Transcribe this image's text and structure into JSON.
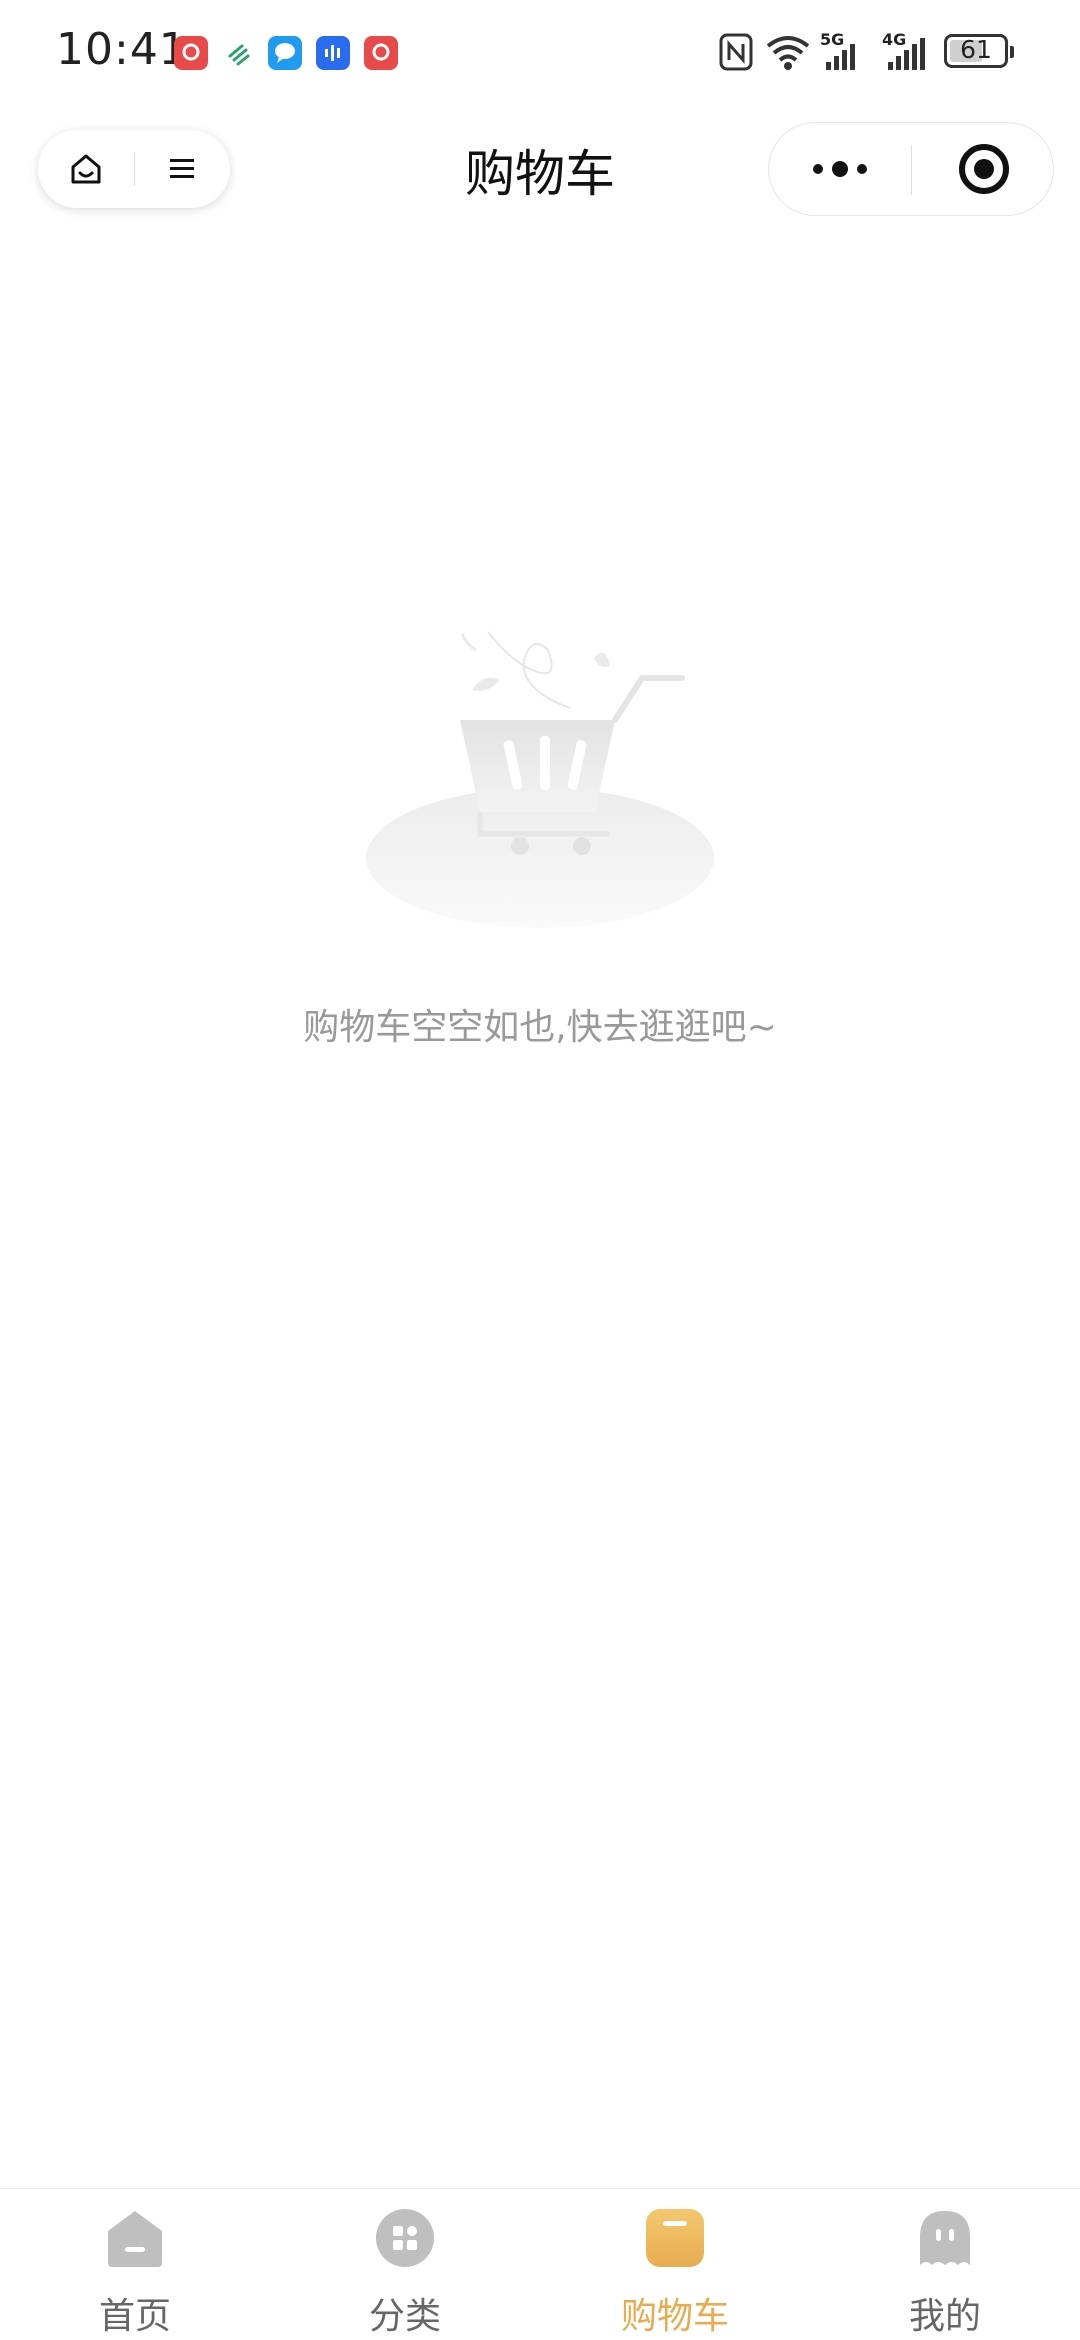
{
  "status_bar": {
    "time": "10:41",
    "notification_icons": [
      "huawei-app-icon",
      "mobile-network-app-icon",
      "messages-app-icon",
      "voice-app-icon",
      "huawei-app-icon"
    ],
    "network_5g": "5G",
    "network_4g": "4G",
    "battery": "61",
    "battery_level": 0.61
  },
  "nav": {
    "title": "购物车",
    "home_icon": "home-icon",
    "menu_icon": "menu-icon",
    "more_icon": "more-icon",
    "close_icon": "target-close-icon"
  },
  "empty_state": {
    "message": "购物车空空如也,快去逛逛吧~",
    "illustration": "empty-cart-illustration"
  },
  "tab_bar": {
    "active_color": "#e8ac4f",
    "inactive_color": "#bfbfbf",
    "items": [
      {
        "label": "首页",
        "icon": "home-tab-icon"
      },
      {
        "label": "分类",
        "icon": "category-tab-icon"
      },
      {
        "label": "购物车",
        "icon": "cart-tab-icon",
        "active": true
      },
      {
        "label": "我的",
        "icon": "profile-tab-icon"
      }
    ]
  }
}
